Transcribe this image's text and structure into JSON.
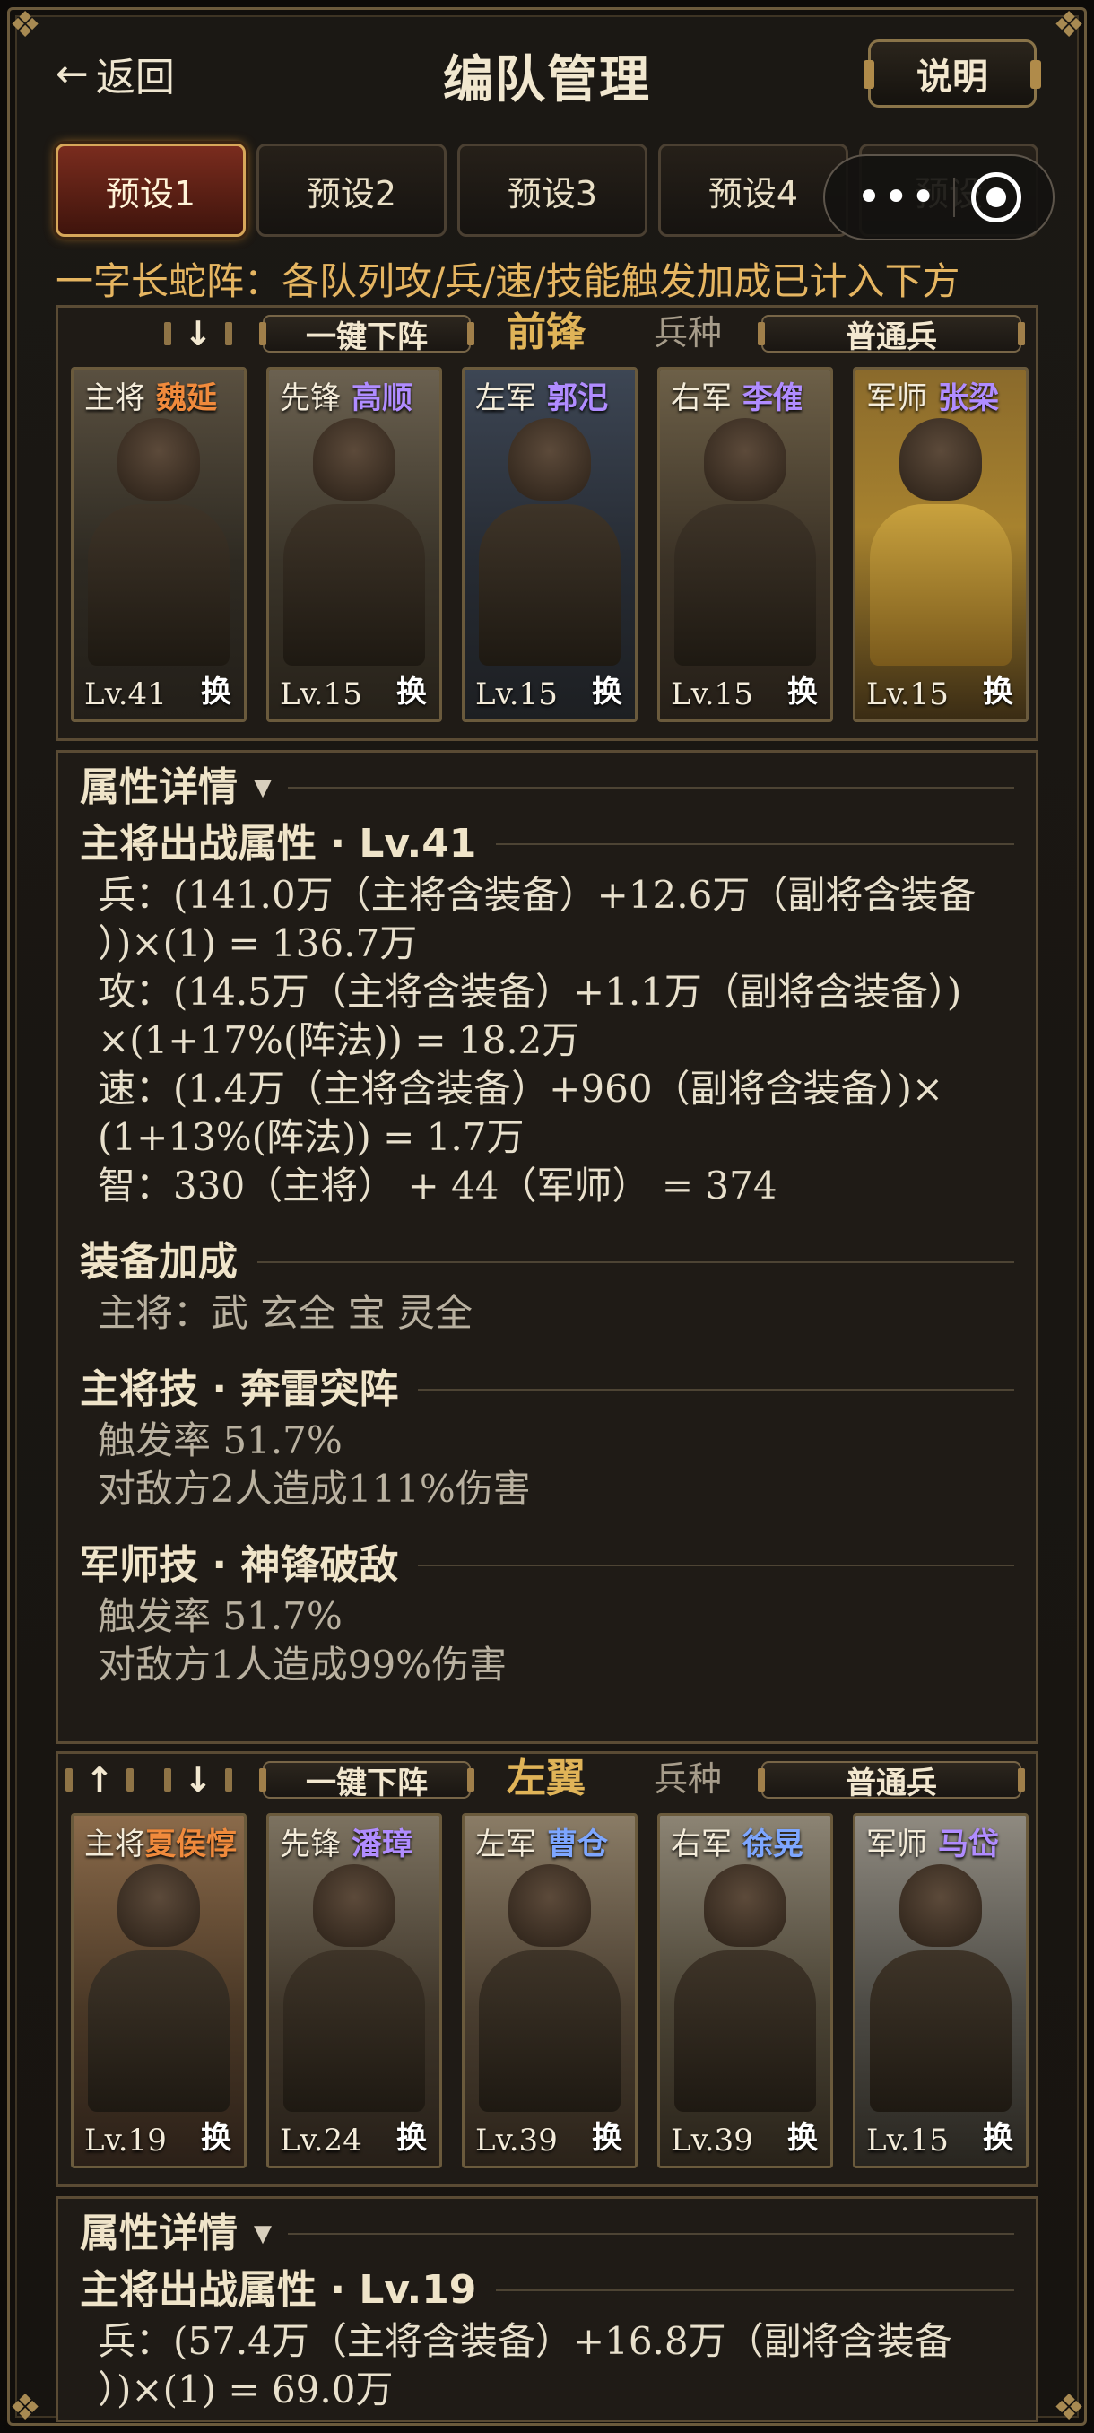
{
  "header": {
    "back_label": "返回",
    "title": "编队管理",
    "help_label": "说明"
  },
  "tabs": [
    "预设1",
    "预设2",
    "预设3",
    "预设4",
    "预设"
  ],
  "formation_text": "一字长蛇阵：各队列攻/兵/速/技能触发加成已计入下方",
  "squads": [
    {
      "position": "前锋",
      "quick_remove": "一键下阵",
      "unit_type_label": "兵种",
      "unit_type": "普通兵",
      "arrows": [
        "↓"
      ],
      "cards": [
        {
          "role": "主将",
          "name": "魏延",
          "name_color": "#f08a3c",
          "level": "Lv.41",
          "swap": "换"
        },
        {
          "role": "先锋",
          "name": "高顺",
          "name_color": "#b08cff",
          "level": "Lv.15",
          "swap": "换"
        },
        {
          "role": "左军",
          "name": "郭汜",
          "name_color": "#b08cff",
          "level": "Lv.15",
          "swap": "换"
        },
        {
          "role": "右军",
          "name": "李傕",
          "name_color": "#b08cff",
          "level": "Lv.15",
          "swap": "换"
        },
        {
          "role": "军师",
          "name": "张梁",
          "name_color": "#b08cff",
          "level": "Lv.15",
          "swap": "换"
        }
      ]
    },
    {
      "position": "左翼",
      "quick_remove": "一键下阵",
      "unit_type_label": "兵种",
      "unit_type": "普通兵",
      "arrows": [
        "↑",
        "↓"
      ],
      "cards": [
        {
          "role": "主将",
          "name": "夏侯惇",
          "name_color": "#f08a3c",
          "level": "Lv.19",
          "swap": "换"
        },
        {
          "role": "先锋",
          "name": "潘璋",
          "name_color": "#b08cff",
          "level": "Lv.24",
          "swap": "换"
        },
        {
          "role": "左军",
          "name": "曹仓",
          "name_color": "#7da6ff",
          "level": "Lv.39",
          "swap": "换"
        },
        {
          "role": "右军",
          "name": "徐晃",
          "name_color": "#7da6ff",
          "level": "Lv.39",
          "swap": "换"
        },
        {
          "role": "军师",
          "name": "马岱",
          "name_color": "#b08cff",
          "level": "Lv.15",
          "swap": "换"
        }
      ]
    }
  ],
  "details1": {
    "title": "属性详情",
    "attr_title": "主将出战属性 · Lv.41",
    "attr_lines": [
      "兵：(141.0万（主将含装备）+12.6万（副将含装备",
      "）)×(1) = 136.7万",
      "攻：(14.5万（主将含装备）+1.1万（副将含装备）)",
      "×(1+17%(阵法)) = 18.2万",
      "速：(1.4万（主将含装备）+960（副将含装备）)×",
      "(1+13%(阵法)) = 1.7万",
      "智：330（主将） + 44（军师） = 374"
    ],
    "equip_title": "装备加成",
    "equip_line": "主将：武 玄全  宝 灵全",
    "skill1_title": "主将技 · 奔雷突阵",
    "skill1_lines": [
      "触发率 51.7%",
      "对敌方2人造成111%伤害"
    ],
    "skill2_title": "军师技 · 神锋破敌",
    "skill2_lines": [
      "触发率 51.7%",
      "对敌方1人造成99%伤害"
    ]
  },
  "details2": {
    "title": "属性详情",
    "attr_title": "主将出战属性 · Lv.19",
    "attr_lines": [
      "兵：(57.4万（主将含装备）+16.8万（副将含装备",
      "）)×(1) = 69.0万"
    ]
  }
}
